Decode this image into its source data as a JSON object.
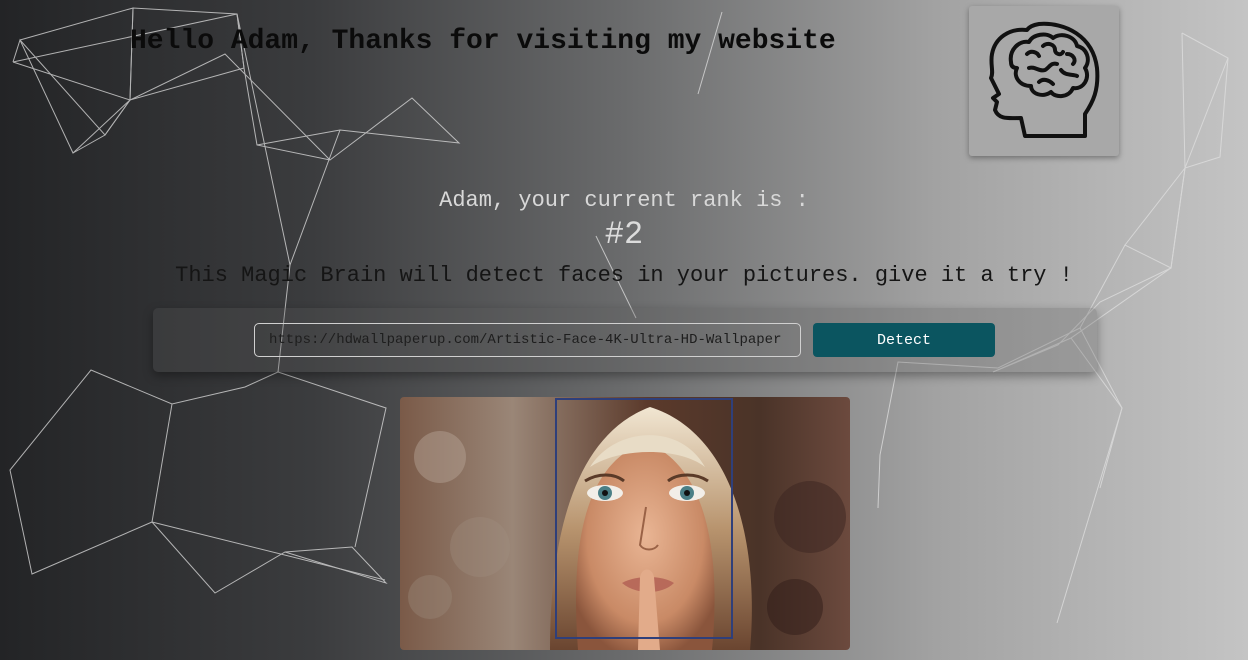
{
  "header": {
    "greeting": "Hello Adam, Thanks for visiting my website",
    "logo_icon": "brain-head-icon"
  },
  "rank": {
    "label": "Adam, your current rank is :",
    "value": "#2"
  },
  "tagline": "This Magic Brain will detect faces in your pictures. give it a try !",
  "form": {
    "url_value": "https://hdwallpaperup.com/Artistic-Face-4K-Ultra-HD-Wallpaper",
    "detect_label": "Detect"
  },
  "colors": {
    "button": "#0b5560",
    "face_box": "#2f3f7a"
  }
}
